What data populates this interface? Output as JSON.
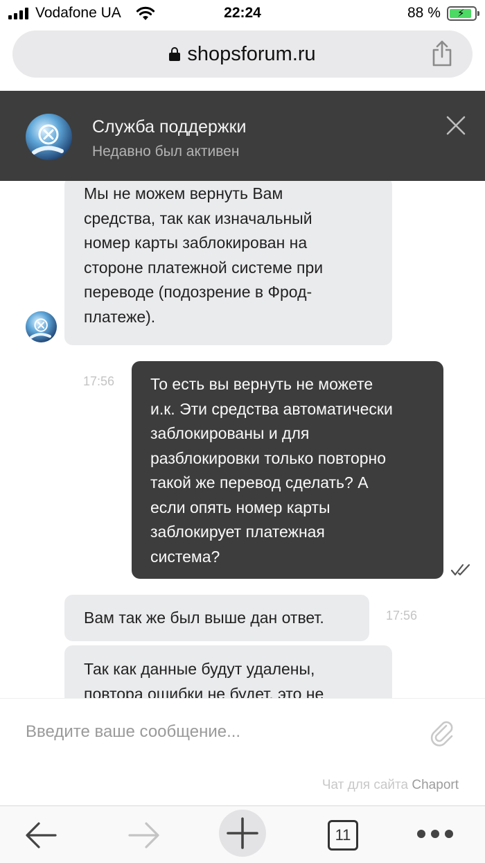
{
  "status_bar": {
    "carrier": "Vodafone UA",
    "time": "22:24",
    "battery_percent": "88 %",
    "battery_level": 0.88
  },
  "browser": {
    "url": "shopsforum.ru"
  },
  "chat_header": {
    "title": "Служба поддержки",
    "subtitle": "Недавно был активен"
  },
  "messages": [
    {
      "direction": "incoming",
      "lines": [
        "Мы не можем вернуть Вам",
        "средства, так как изначальный",
        "номер карты заблокирован на",
        "стороне платежной системе при",
        "переводе (подозрение в Фрод-",
        "платеже)."
      ]
    },
    {
      "direction": "outgoing",
      "time": "17:56",
      "status_icon": "double-check-icon",
      "lines": [
        "То есть вы вернуть не можете",
        "и.к. Эти средства автоматически",
        "заблокированы и для",
        "разблокировки только повторно",
        "такой же перевод сделать? А",
        "если опять номер карты",
        "заблокирует платежная",
        "система?"
      ]
    },
    {
      "direction": "incoming",
      "time": "17:56",
      "lines": [
        "Вам так же был выше дан ответ."
      ]
    },
    {
      "direction": "incoming",
      "lines": [
        "Так как данные будут удалены,",
        "повтора ошибки не будет, это не"
      ]
    }
  ],
  "composer": {
    "placeholder": "Введите ваше сообщение...",
    "powered_by_prefix": "Чат для сайта",
    "powered_by_brand": "Chaport"
  },
  "toolbar": {
    "tab_count": "11"
  },
  "colors": {
    "header_bg": "#3d3d3d",
    "incoming_bubble": "#eaebed",
    "outgoing_bubble": "#3d3d3d",
    "battery": "#4cd964"
  }
}
